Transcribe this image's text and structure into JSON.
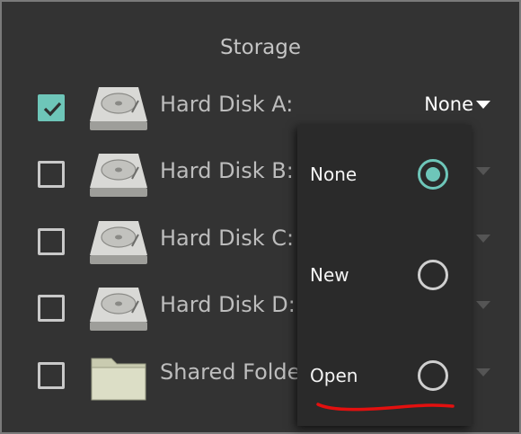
{
  "storage": {
    "title": "Storage",
    "items": [
      {
        "label": "Hard Disk A:",
        "value": "None",
        "checked": true,
        "icon": "hard-disk-icon"
      },
      {
        "label": "Hard Disk B:",
        "checked": false,
        "icon": "hard-disk-icon"
      },
      {
        "label": "Hard Disk C:",
        "checked": false,
        "icon": "hard-disk-icon"
      },
      {
        "label": "Hard Disk D:",
        "checked": false,
        "icon": "hard-disk-icon"
      },
      {
        "label": "Shared Folde",
        "checked": false,
        "icon": "folder-icon"
      }
    ]
  },
  "dropdown_menu": {
    "options": [
      {
        "label": "None",
        "selected": true
      },
      {
        "label": "New",
        "selected": false
      },
      {
        "label": "Open",
        "selected": false
      }
    ]
  },
  "colors": {
    "accent": "#6ec6b9",
    "background": "#333333",
    "annotation": "#e3100f"
  }
}
